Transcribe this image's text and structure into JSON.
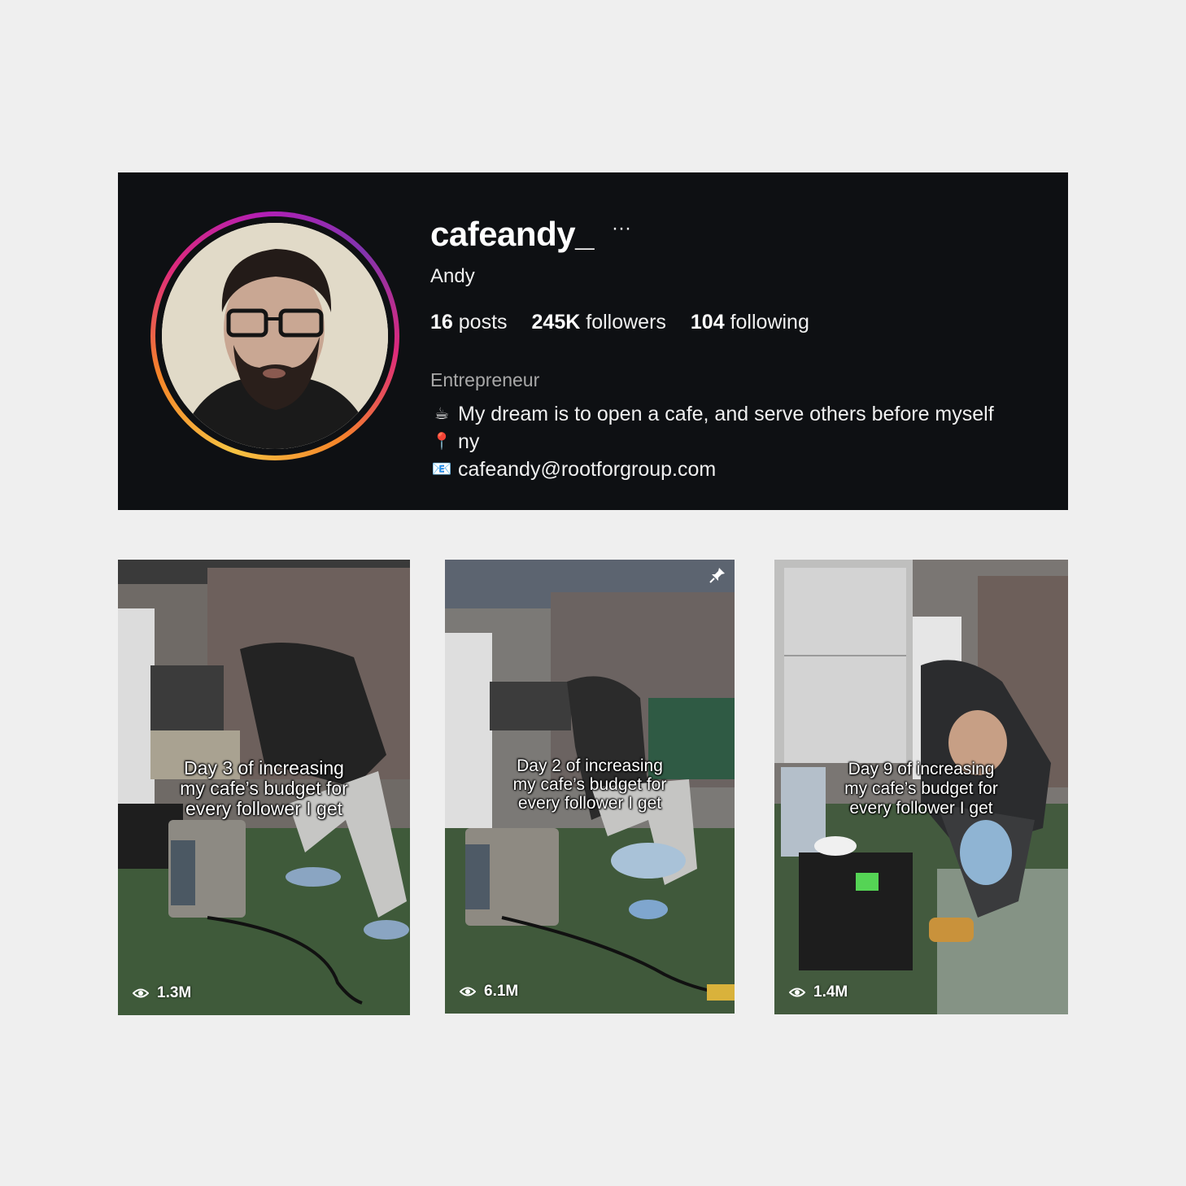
{
  "profile": {
    "username": "cafeandy_",
    "more_glyph": "···",
    "display_name": "Andy",
    "stats": {
      "posts_count": "16",
      "posts_label": "posts",
      "followers_count": "245K",
      "followers_label": "followers",
      "following_count": "104",
      "following_label": "following"
    },
    "category": "Entrepreneur",
    "bio": {
      "line1_emoji": "☕",
      "line1": "My dream is to open a cafe, and serve others before myself",
      "line2_emoji": "📍",
      "line2": "ny",
      "line3_emoji": "📧",
      "line3": "cafeandy@rootforgroup.com"
    }
  },
  "posts": [
    {
      "caption": "Day 3 of increasing\nmy cafe’s budget for\nevery follower I get",
      "views": "1.3M",
      "pinned": false
    },
    {
      "caption": "Day 2 of increasing\nmy cafe’s budget for\nevery follower I get",
      "views": "6.1M",
      "pinned": true
    },
    {
      "caption": "Day 9 of increasing\nmy cafe’s budget for\nevery follower I get",
      "views": "1.4M",
      "pinned": false
    }
  ],
  "colors": {
    "card_bg": "#0e1013",
    "page_bg": "#efefef",
    "ring_gradient": [
      "#f6c343",
      "#f58529",
      "#dd2a7b",
      "#8134af"
    ],
    "secondary_text": "#a8a8a8"
  },
  "icons": {
    "more": "more-options-icon",
    "eye": "eye-icon",
    "pin": "pin-icon"
  }
}
